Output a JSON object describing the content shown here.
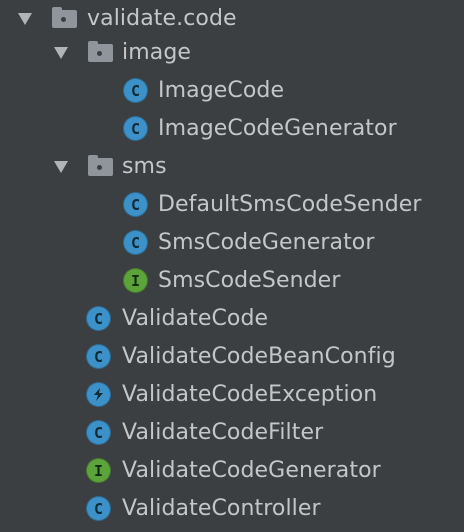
{
  "project_tree": {
    "package": {
      "label": "validate.code",
      "icon": "package-folder-icon",
      "expanded": true
    },
    "subpackages": [
      {
        "label": "image",
        "icon": "package-folder-icon",
        "expanded": true,
        "items": [
          {
            "label": "ImageCode",
            "kind": "class",
            "badge": "C"
          },
          {
            "label": "ImageCodeGenerator",
            "kind": "class",
            "badge": "C"
          }
        ]
      },
      {
        "label": "sms",
        "icon": "package-folder-icon",
        "expanded": true,
        "items": [
          {
            "label": "DefaultSmsCodeSender",
            "kind": "class",
            "badge": "C"
          },
          {
            "label": "SmsCodeGenerator",
            "kind": "class",
            "badge": "C"
          },
          {
            "label": "SmsCodeSender",
            "kind": "interface",
            "badge": "I"
          }
        ]
      }
    ],
    "files": [
      {
        "label": "ValidateCode",
        "kind": "class",
        "badge": "C"
      },
      {
        "label": "ValidateCodeBeanConfig",
        "kind": "class",
        "badge": "C"
      },
      {
        "label": "ValidateCodeException",
        "kind": "exception",
        "badge": "lightning"
      },
      {
        "label": "ValidateCodeFilter",
        "kind": "class",
        "badge": "C"
      },
      {
        "label": "ValidateCodeGenerator",
        "kind": "interface",
        "badge": "I"
      },
      {
        "label": "ValidateController",
        "kind": "class",
        "badge": "C"
      }
    ]
  },
  "colors": {
    "background": "#3c3f41",
    "text": "#c4c7c9",
    "class_badge": "#3c91c8",
    "interface_badge": "#5da33b",
    "folder": "#8f959b",
    "arrow": "#b1b4b6"
  }
}
